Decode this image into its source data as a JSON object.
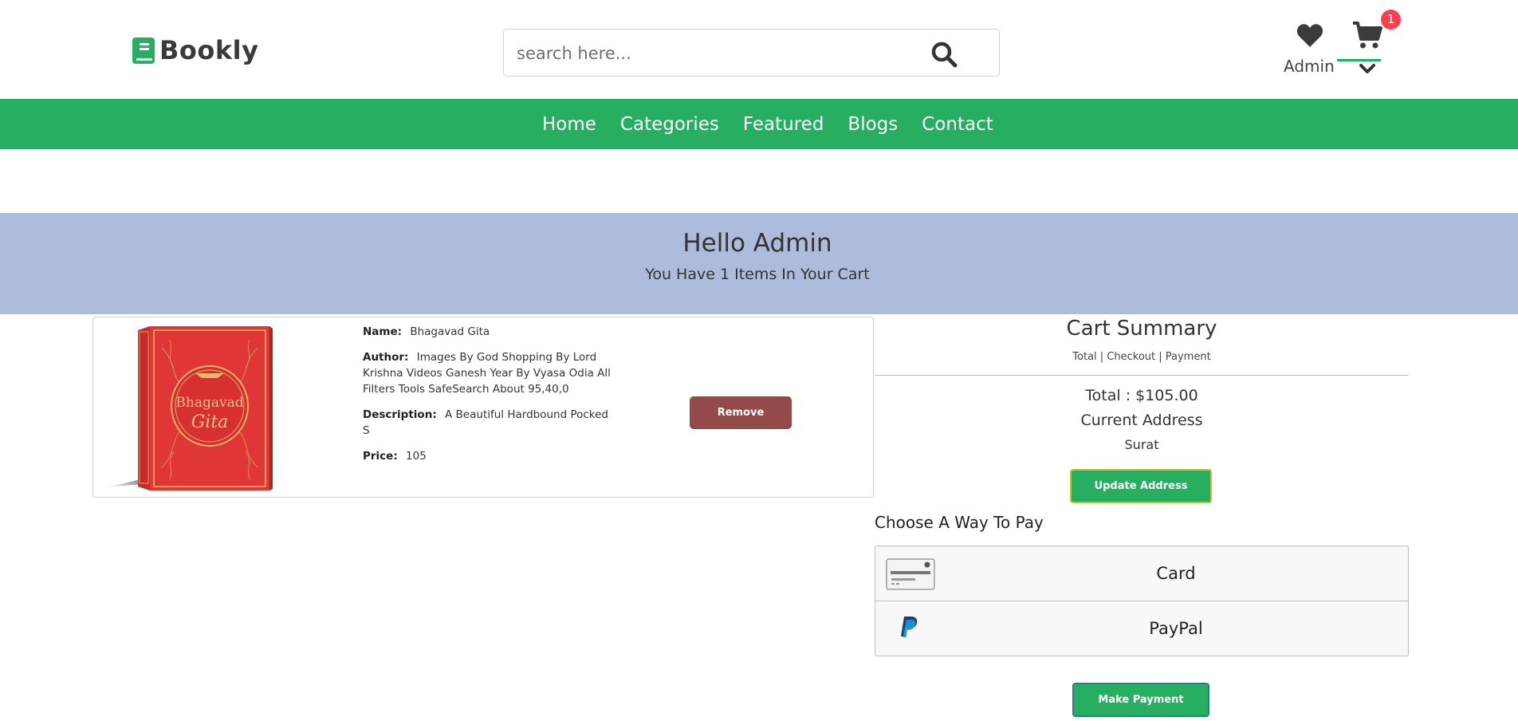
{
  "header": {
    "logo_text": "Bookly",
    "search": {
      "placeholder": "search here...",
      "value": ""
    },
    "cart_count": "1",
    "user_label": "Admin",
    "icons": [
      "book-icon",
      "search-icon",
      "heart-icon",
      "cart-icon",
      "chevron-down-icon"
    ]
  },
  "nav": {
    "items": [
      {
        "label": "Home"
      },
      {
        "label": "Categories"
      },
      {
        "label": "Featured"
      },
      {
        "label": "Blogs"
      },
      {
        "label": "Contact"
      }
    ]
  },
  "banner": {
    "title": "Hello Admin",
    "subtitle": "You Have 1 Items In Your Cart"
  },
  "cart_item": {
    "name_label": "Name:",
    "name": "Bhagavad Gita",
    "author_label": "Author:",
    "author": "Images By God Shopping By Lord Krishna Videos Ganesh Year By Vyasa Odia All Filters Tools SafeSearch About 95,40,0",
    "description_label": "Description:",
    "description": "A Beautiful Hardbound Pocked S",
    "price_label": "Price:",
    "price": "105",
    "remove_label": "Remove",
    "cover_title_line1": "Bhagavad",
    "cover_title_line2": "Gita"
  },
  "summary": {
    "title": "Cart Summary",
    "steps": "Total | Checkout | Payment",
    "total": "Total : $105.00",
    "address_label": "Current Address",
    "address": "Surat",
    "update_label": "Update Address",
    "pay_heading": "Choose A Way To Pay",
    "pay_options": [
      {
        "label": "Card",
        "icon": "credit-card-icon"
      },
      {
        "label": "PayPal",
        "icon": "paypal-icon"
      }
    ],
    "make_payment_label": "Make Payment"
  },
  "colors": {
    "brand_green": "#27ae60",
    "banner_bg": "#adbbdd",
    "remove_btn": "#954a4a",
    "badge_red": "#ff3f4e"
  }
}
